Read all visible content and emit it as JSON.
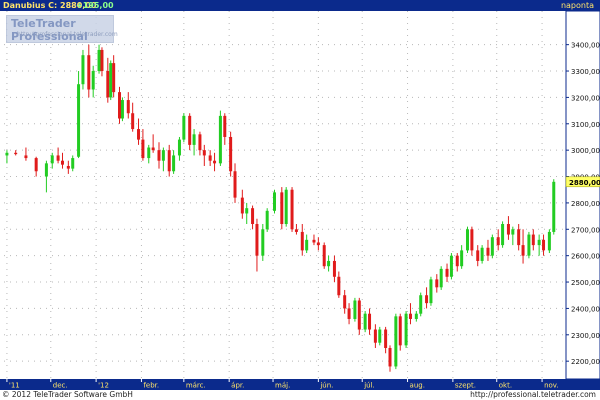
{
  "header": {
    "instrument_label": "Danubius C: 2880,00",
    "change_label": "+195,00",
    "period_label": "naponta"
  },
  "logo": {
    "name": "TeleTrader Professional",
    "url": "http://professional.teletrader.com"
  },
  "footer": {
    "copyright": "© 2012 TeleTrader Software GmbH",
    "url": "http://professional.teletrader.com"
  },
  "colors": {
    "up": "#22cc22",
    "down": "#e01b1b",
    "flat": "#9fe3e3",
    "axis_band": "#0b2a8c",
    "price_tag_bg": "#ffff66",
    "grid_dot": "#b8b8b8"
  },
  "chart_data": {
    "type": "ohlc",
    "title": "",
    "ylim": [
      2140,
      3520
    ],
    "y_ticks": [
      2200,
      2300,
      2400,
      2500,
      2600,
      2700,
      2800,
      2900,
      3000,
      3100,
      3200,
      3300,
      3400
    ],
    "y_tick_labels": [
      "2200,00",
      "2300,00",
      "2400,00",
      "2500,00",
      "2600,00",
      "2700,00",
      "2800,00",
      "2900,00",
      "3000,00",
      "3100,00",
      "3200,00",
      "3300,00",
      "3400,00"
    ],
    "x_tick_labels": [
      {
        "label": "'11",
        "date": "2011-11-01"
      },
      {
        "label": "dec.",
        "date": "2011-12-01"
      },
      {
        "label": "'12",
        "date": "2012-01-01"
      },
      {
        "label": "febr.",
        "date": "2012-02-01"
      },
      {
        "label": "márc.",
        "date": "2012-03-01"
      },
      {
        "label": "ápr.",
        "date": "2012-04-01"
      },
      {
        "label": "máj.",
        "date": "2012-05-01"
      },
      {
        "label": "jún.",
        "date": "2012-06-01"
      },
      {
        "label": "júl.",
        "date": "2012-07-01"
      },
      {
        "label": "aug.",
        "date": "2012-08-01"
      },
      {
        "label": "szept.",
        "date": "2012-09-01"
      },
      {
        "label": "okt.",
        "date": "2012-10-01"
      },
      {
        "label": "nov.",
        "date": "2012-11-01"
      }
    ],
    "last_value": 2880,
    "last_value_label": "2880,00",
    "bars": [
      {
        "date": "2011-11-01",
        "open": 2980,
        "high": 3000,
        "low": 2950,
        "close": 2990
      },
      {
        "date": "2011-11-07",
        "open": 2990,
        "high": 3000,
        "low": 2980,
        "close": 2985
      },
      {
        "date": "2011-11-14",
        "open": 2980,
        "high": 3010,
        "low": 2960,
        "close": 2970
      },
      {
        "date": "2011-11-21",
        "open": 2970,
        "high": 2975,
        "low": 2900,
        "close": 2920
      },
      {
        "date": "2011-11-28",
        "open": 2900,
        "high": 2960,
        "low": 2840,
        "close": 2950
      },
      {
        "date": "2011-12-02",
        "open": 2950,
        "high": 2990,
        "low": 2930,
        "close": 2980
      },
      {
        "date": "2011-12-06",
        "open": 2980,
        "high": 3010,
        "low": 2950,
        "close": 2960
      },
      {
        "date": "2011-12-09",
        "open": 2960,
        "high": 2990,
        "low": 2930,
        "close": 2945
      },
      {
        "date": "2011-12-13",
        "open": 2940,
        "high": 2960,
        "low": 2910,
        "close": 2930
      },
      {
        "date": "2011-12-16",
        "open": 2930,
        "high": 2980,
        "low": 2920,
        "close": 2970
      },
      {
        "date": "2011-12-20",
        "open": 2975,
        "high": 3300,
        "low": 2970,
        "close": 3250
      },
      {
        "date": "2011-12-23",
        "open": 3250,
        "high": 3380,
        "low": 3230,
        "close": 3360
      },
      {
        "date": "2011-12-27",
        "open": 3360,
        "high": 3400,
        "low": 3200,
        "close": 3230
      },
      {
        "date": "2011-12-30",
        "open": 3230,
        "high": 3320,
        "low": 3200,
        "close": 3300
      },
      {
        "date": "2012-01-03",
        "open": 3300,
        "high": 3400,
        "low": 3290,
        "close": 3380
      },
      {
        "date": "2012-01-05",
        "open": 3380,
        "high": 3390,
        "low": 3280,
        "close": 3300
      },
      {
        "date": "2012-01-09",
        "open": 3300,
        "high": 3350,
        "low": 3180,
        "close": 3200
      },
      {
        "date": "2012-01-11",
        "open": 3200,
        "high": 3340,
        "low": 3190,
        "close": 3330
      },
      {
        "date": "2012-01-13",
        "open": 3330,
        "high": 3360,
        "low": 3200,
        "close": 3220
      },
      {
        "date": "2012-01-17",
        "open": 3220,
        "high": 3240,
        "low": 3100,
        "close": 3120
      },
      {
        "date": "2012-01-19",
        "open": 3120,
        "high": 3200,
        "low": 3110,
        "close": 3190
      },
      {
        "date": "2012-01-23",
        "open": 3190,
        "high": 3220,
        "low": 3120,
        "close": 3140
      },
      {
        "date": "2012-01-26",
        "open": 3140,
        "high": 3180,
        "low": 3070,
        "close": 3080
      },
      {
        "date": "2012-01-30",
        "open": 3080,
        "high": 3120,
        "low": 3020,
        "close": 3040
      },
      {
        "date": "2012-02-02",
        "open": 3040,
        "high": 3080,
        "low": 2960,
        "close": 2970
      },
      {
        "date": "2012-02-06",
        "open": 2970,
        "high": 3020,
        "low": 2950,
        "close": 3010
      },
      {
        "date": "2012-02-09",
        "open": 3010,
        "high": 3060,
        "low": 2990,
        "close": 3000
      },
      {
        "date": "2012-02-13",
        "open": 3000,
        "high": 3030,
        "low": 2930,
        "close": 2960
      },
      {
        "date": "2012-02-16",
        "open": 2960,
        "high": 3010,
        "low": 2920,
        "close": 3000
      },
      {
        "date": "2012-02-20",
        "open": 3000,
        "high": 3020,
        "low": 2900,
        "close": 2920
      },
      {
        "date": "2012-02-23",
        "open": 2920,
        "high": 3000,
        "low": 2910,
        "close": 2980
      },
      {
        "date": "2012-02-27",
        "open": 2980,
        "high": 3050,
        "low": 2960,
        "close": 3040
      },
      {
        "date": "2012-03-01",
        "open": 3040,
        "high": 3140,
        "low": 3030,
        "close": 3130
      },
      {
        "date": "2012-03-05",
        "open": 3130,
        "high": 3140,
        "low": 3000,
        "close": 3020
      },
      {
        "date": "2012-03-08",
        "open": 3020,
        "high": 3080,
        "low": 2980,
        "close": 3060
      },
      {
        "date": "2012-03-12",
        "open": 3060,
        "high": 3070,
        "low": 2980,
        "close": 3000
      },
      {
        "date": "2012-03-15",
        "open": 3000,
        "high": 3020,
        "low": 2940,
        "close": 2980
      },
      {
        "date": "2012-03-19",
        "open": 2980,
        "high": 3000,
        "low": 2940,
        "close": 2960
      },
      {
        "date": "2012-03-22",
        "open": 2960,
        "high": 2990,
        "low": 2920,
        "close": 2950
      },
      {
        "date": "2012-03-26",
        "open": 2950,
        "high": 3150,
        "low": 2940,
        "close": 3130
      },
      {
        "date": "2012-03-29",
        "open": 3130,
        "high": 3140,
        "low": 3020,
        "close": 3050
      },
      {
        "date": "2012-04-02",
        "open": 3050,
        "high": 3070,
        "low": 2900,
        "close": 2920
      },
      {
        "date": "2012-04-05",
        "open": 2920,
        "high": 2950,
        "low": 2800,
        "close": 2820
      },
      {
        "date": "2012-04-10",
        "open": 2820,
        "high": 2850,
        "low": 2740,
        "close": 2760
      },
      {
        "date": "2012-04-13",
        "open": 2760,
        "high": 2800,
        "low": 2720,
        "close": 2780
      },
      {
        "date": "2012-04-17",
        "open": 2780,
        "high": 2790,
        "low": 2700,
        "close": 2720
      },
      {
        "date": "2012-04-20",
        "open": 2720,
        "high": 2740,
        "low": 2540,
        "close": 2600
      },
      {
        "date": "2012-04-24",
        "open": 2600,
        "high": 2720,
        "low": 2580,
        "close": 2700
      },
      {
        "date": "2012-04-27",
        "open": 2700,
        "high": 2780,
        "low": 2690,
        "close": 2770
      },
      {
        "date": "2012-05-02",
        "open": 2770,
        "high": 2850,
        "low": 2760,
        "close": 2840
      },
      {
        "date": "2012-05-07",
        "open": 2840,
        "high": 2860,
        "low": 2700,
        "close": 2720
      },
      {
        "date": "2012-05-10",
        "open": 2720,
        "high": 2860,
        "low": 2710,
        "close": 2850
      },
      {
        "date": "2012-05-14",
        "open": 2850,
        "high": 2860,
        "low": 2690,
        "close": 2700
      },
      {
        "date": "2012-05-17",
        "open": 2700,
        "high": 2720,
        "low": 2680,
        "close": 2690
      },
      {
        "date": "2012-05-21",
        "open": 2690,
        "high": 2720,
        "low": 2600,
        "close": 2620
      },
      {
        "date": "2012-05-24",
        "open": 2620,
        "high": 2680,
        "low": 2610,
        "close": 2660
      },
      {
        "date": "2012-05-29",
        "open": 2660,
        "high": 2680,
        "low": 2640,
        "close": 2650
      },
      {
        "date": "2012-06-01",
        "open": 2650,
        "high": 2670,
        "low": 2620,
        "close": 2640
      },
      {
        "date": "2012-06-05",
        "open": 2640,
        "high": 2650,
        "low": 2550,
        "close": 2560
      },
      {
        "date": "2012-06-08",
        "open": 2560,
        "high": 2600,
        "low": 2540,
        "close": 2580
      },
      {
        "date": "2012-06-12",
        "open": 2580,
        "high": 2600,
        "low": 2500,
        "close": 2520
      },
      {
        "date": "2012-06-15",
        "open": 2520,
        "high": 2540,
        "low": 2440,
        "close": 2450
      },
      {
        "date": "2012-06-19",
        "open": 2450,
        "high": 2470,
        "low": 2380,
        "close": 2400
      },
      {
        "date": "2012-06-22",
        "open": 2400,
        "high": 2420,
        "low": 2340,
        "close": 2360
      },
      {
        "date": "2012-06-26",
        "open": 2360,
        "high": 2440,
        "low": 2350,
        "close": 2430
      },
      {
        "date": "2012-06-29",
        "open": 2430,
        "high": 2440,
        "low": 2300,
        "close": 2320
      },
      {
        "date": "2012-07-03",
        "open": 2320,
        "high": 2390,
        "low": 2310,
        "close": 2380
      },
      {
        "date": "2012-07-06",
        "open": 2380,
        "high": 2400,
        "low": 2300,
        "close": 2320
      },
      {
        "date": "2012-07-10",
        "open": 2320,
        "high": 2340,
        "low": 2250,
        "close": 2270
      },
      {
        "date": "2012-07-13",
        "open": 2270,
        "high": 2330,
        "low": 2260,
        "close": 2320
      },
      {
        "date": "2012-07-17",
        "open": 2320,
        "high": 2330,
        "low": 2230,
        "close": 2250
      },
      {
        "date": "2012-07-20",
        "open": 2250,
        "high": 2260,
        "low": 2160,
        "close": 2180
      },
      {
        "date": "2012-07-24",
        "open": 2180,
        "high": 2380,
        "low": 2170,
        "close": 2370
      },
      {
        "date": "2012-07-27",
        "open": 2370,
        "high": 2380,
        "low": 2240,
        "close": 2260
      },
      {
        "date": "2012-07-31",
        "open": 2260,
        "high": 2390,
        "low": 2250,
        "close": 2380
      },
      {
        "date": "2012-08-03",
        "open": 2380,
        "high": 2420,
        "low": 2340,
        "close": 2360
      },
      {
        "date": "2012-08-07",
        "open": 2360,
        "high": 2390,
        "low": 2350,
        "close": 2380
      },
      {
        "date": "2012-08-10",
        "open": 2380,
        "high": 2460,
        "low": 2370,
        "close": 2450
      },
      {
        "date": "2012-08-14",
        "open": 2450,
        "high": 2480,
        "low": 2400,
        "close": 2420
      },
      {
        "date": "2012-08-17",
        "open": 2420,
        "high": 2520,
        "low": 2410,
        "close": 2510
      },
      {
        "date": "2012-08-21",
        "open": 2510,
        "high": 2530,
        "low": 2460,
        "close": 2480
      },
      {
        "date": "2012-08-24",
        "open": 2480,
        "high": 2560,
        "low": 2470,
        "close": 2550
      },
      {
        "date": "2012-08-28",
        "open": 2550,
        "high": 2570,
        "low": 2500,
        "close": 2520
      },
      {
        "date": "2012-08-31",
        "open": 2520,
        "high": 2610,
        "low": 2510,
        "close": 2600
      },
      {
        "date": "2012-09-04",
        "open": 2600,
        "high": 2610,
        "low": 2540,
        "close": 2560
      },
      {
        "date": "2012-09-07",
        "open": 2560,
        "high": 2640,
        "low": 2550,
        "close": 2620
      },
      {
        "date": "2012-09-11",
        "open": 2620,
        "high": 2710,
        "low": 2610,
        "close": 2700
      },
      {
        "date": "2012-09-14",
        "open": 2700,
        "high": 2710,
        "low": 2600,
        "close": 2620
      },
      {
        "date": "2012-09-18",
        "open": 2620,
        "high": 2640,
        "low": 2560,
        "close": 2580
      },
      {
        "date": "2012-09-21",
        "open": 2580,
        "high": 2640,
        "low": 2570,
        "close": 2630
      },
      {
        "date": "2012-09-25",
        "open": 2630,
        "high": 2660,
        "low": 2580,
        "close": 2600
      },
      {
        "date": "2012-09-28",
        "open": 2600,
        "high": 2680,
        "low": 2590,
        "close": 2670
      },
      {
        "date": "2012-10-02",
        "open": 2670,
        "high": 2700,
        "low": 2620,
        "close": 2640
      },
      {
        "date": "2012-10-05",
        "open": 2640,
        "high": 2730,
        "low": 2630,
        "close": 2720
      },
      {
        "date": "2012-10-09",
        "open": 2720,
        "high": 2750,
        "low": 2660,
        "close": 2680
      },
      {
        "date": "2012-10-12",
        "open": 2680,
        "high": 2710,
        "low": 2640,
        "close": 2700
      },
      {
        "date": "2012-10-16",
        "open": 2700,
        "high": 2720,
        "low": 2620,
        "close": 2640
      },
      {
        "date": "2012-10-19",
        "open": 2640,
        "high": 2700,
        "low": 2570,
        "close": 2600
      },
      {
        "date": "2012-10-23",
        "open": 2600,
        "high": 2690,
        "low": 2590,
        "close": 2680
      },
      {
        "date": "2012-10-26",
        "open": 2680,
        "high": 2700,
        "low": 2620,
        "close": 2640
      },
      {
        "date": "2012-10-30",
        "open": 2640,
        "high": 2680,
        "low": 2600,
        "close": 2660
      },
      {
        "date": "2012-11-02",
        "open": 2660,
        "high": 2680,
        "low": 2600,
        "close": 2620
      },
      {
        "date": "2012-11-06",
        "open": 2620,
        "high": 2700,
        "low": 2610,
        "close": 2690
      },
      {
        "date": "2012-11-09",
        "open": 2690,
        "high": 2890,
        "low": 2680,
        "close": 2880
      }
    ]
  }
}
